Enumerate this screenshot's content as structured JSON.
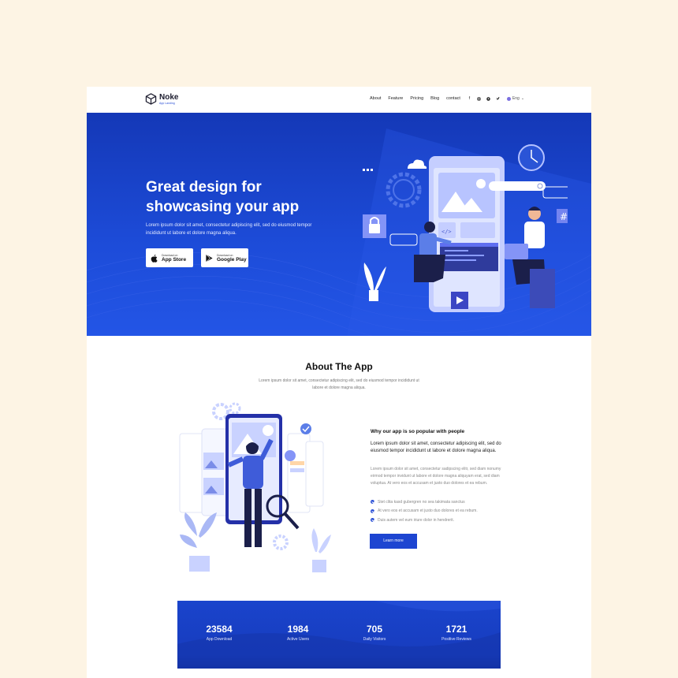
{
  "brand": {
    "name": "Noke",
    "tagline": "App Landing"
  },
  "nav": {
    "links": [
      "About",
      "Feature",
      "Pricing",
      "Blog",
      "contact"
    ],
    "social_icons": [
      "facebook-icon",
      "instagram-icon",
      "pinterest-icon",
      "twitter-icon"
    ],
    "language": "Eng"
  },
  "hero": {
    "title_line1": "Great design for",
    "title_line2": "showcasing your app",
    "description": "Lorem ipsum dolor sit amet, consectetur adipiscing elit, sed do eiusmod tempor incididunt ut labore et dolore magna aliqua.",
    "app_store": {
      "small": "Download on",
      "big": "App Store"
    },
    "google_play": {
      "small": "Download on",
      "big": "Google Play"
    }
  },
  "about": {
    "title": "About The App",
    "subtitle": "Lorem ipsum dolor sit amet, consectetur adipiscing elit, sed do eiusmod tempor incididunt ut labore et dolore magna aliqua.",
    "why_title": "Why our app is so popular with people",
    "lead": "Lorem ipsum dolor sit amet, consectetur adipiscing elit, sed do eiusmod tempor incididunt ut labore et dolore magna aliqua.",
    "body": "Lorem ipsum dolor sit amet, consectetur sadipscing elitr, sed diam nonumy eirmod tempor invidunt ut labore et dolore magna aliquyam erat, sed diam voluptua. At vero eos et accusam et justo duo dolores et ea rebum.",
    "checklist": [
      "Stet clita kasd gubergren no sea takimata sanctus",
      "At vero eos et accusam et justo duo dolores et ea rebum.",
      "Duis autem vel eum iriure dolor in hendrerit."
    ],
    "button": "Learn more"
  },
  "stats": [
    {
      "value": "23584",
      "label": "App Download"
    },
    {
      "value": "1984",
      "label": "Active Users"
    },
    {
      "value": "705",
      "label": "Daily Visitors"
    },
    {
      "value": "1721",
      "label": "Positive Reviews"
    }
  ],
  "colors": {
    "primary": "#1d4cd9",
    "accent_light": "#c9d2ff",
    "page_bg": "#fdf4e4"
  }
}
